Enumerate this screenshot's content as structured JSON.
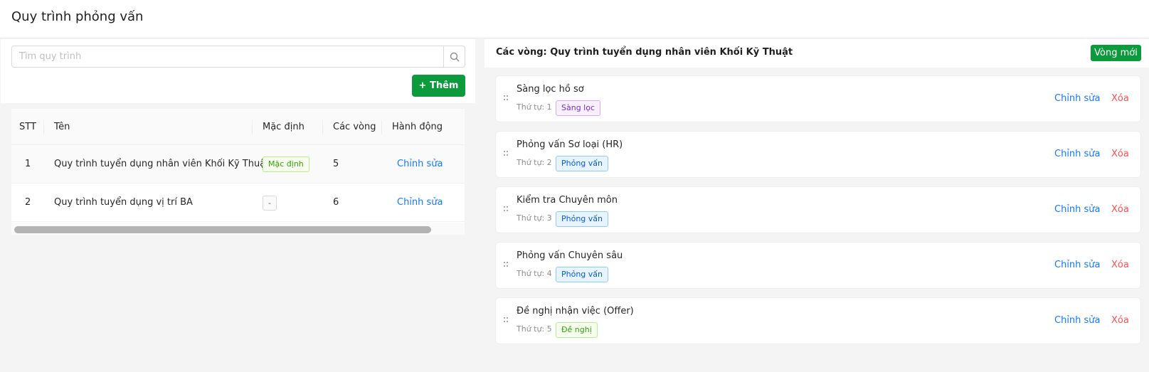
{
  "page": {
    "title": "Quy trình phỏng vấn"
  },
  "search": {
    "placeholder": "Tìm quy trình",
    "icon": "search-icon"
  },
  "toolbar": {
    "add_label": "+ Thêm"
  },
  "table": {
    "columns": [
      "STT",
      "Tên",
      "Mặc định",
      "Các vòng",
      "Hành động"
    ],
    "rows": [
      {
        "stt": "1",
        "name": "Quy trình tuyển dụng nhân viên Khối Kỹ Thuật",
        "default": "Mặc định",
        "rounds": "5",
        "action": "Chỉnh sửa"
      },
      {
        "stt": "2",
        "name": "Quy trình tuyển dụng vị trí BA",
        "default": "-",
        "rounds": "6",
        "action": "Chỉnh sửa"
      }
    ]
  },
  "rounds_panel": {
    "title": "Các vòng: Quy trình tuyển dụng nhân viên Khối Kỹ Thuật",
    "new_round_label": "Vòng mới",
    "edit_label": "Chỉnh sửa",
    "delete_label": "Xóa",
    "rounds": [
      {
        "name": "Sàng lọc hồ sơ",
        "order": "Thứ tự: 1",
        "tag": "Sàng lọc",
        "tag_color": "#722ed1"
      },
      {
        "name": "Phỏng vấn Sơ loại (HR)",
        "order": "Thứ tự: 2",
        "tag": "Phỏng vấn",
        "tag_color": "#0958d9"
      },
      {
        "name": "Kiểm tra Chuyên môn",
        "order": "Thứ tự: 3",
        "tag": "Phỏng vấn",
        "tag_color": "#0958d9"
      },
      {
        "name": "Phỏng vấn Chuyên sâu",
        "order": "Thứ tự: 4",
        "tag": "Phỏng vấn",
        "tag_color": "#0958d9"
      },
      {
        "name": "Đề nghị nhận việc (Offer)",
        "order": "Thứ tự: 5",
        "tag": "Đề nghị",
        "tag_color": "#389e0d"
      }
    ]
  },
  "colors": {
    "primary_green": "#0c9b3c",
    "link_blue": "#1677ff",
    "danger_red": "#ff4d4f"
  }
}
